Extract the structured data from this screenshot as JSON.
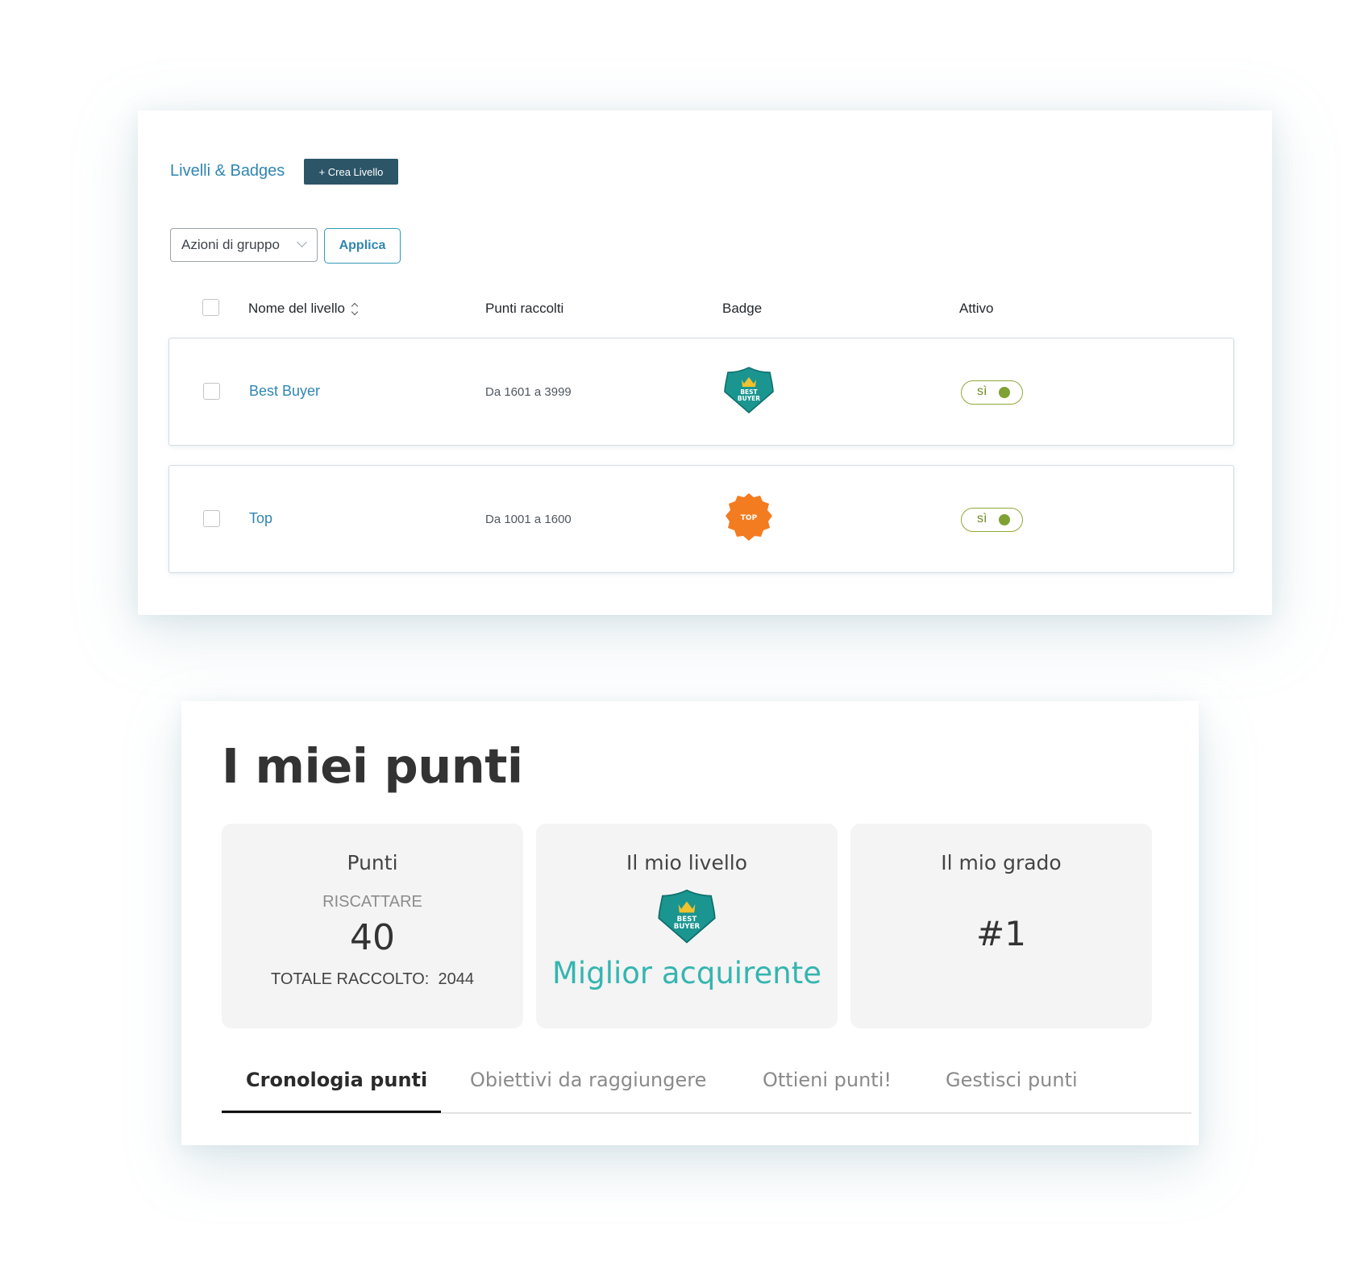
{
  "admin": {
    "title": "Livelli & Badges",
    "create_button": "+ Crea Livello",
    "bulk_actions": {
      "selected": "Azioni di gruppo"
    },
    "apply_button": "Applica",
    "columns": [
      "Nome del livello",
      "Punti raccolti",
      "Badge",
      "Attivo"
    ],
    "rows": [
      {
        "name": "Best Buyer",
        "range": "Da 1601 a 3999",
        "badge": {
          "icon": "best-buyer-badge-icon",
          "lines": [
            "BEST",
            "BUYER"
          ],
          "color": "#1a9590"
        },
        "active": "sì"
      },
      {
        "name": "Top",
        "range": "Da 1001 a 1600",
        "badge": {
          "icon": "top-badge-icon",
          "lines": [
            "TOP"
          ],
          "color": "#f47c20"
        },
        "active": "sì"
      }
    ],
    "colors": {
      "accent": "#2f86b3",
      "button_dark": "#2c5568",
      "toggle_green": "#7fa133"
    }
  },
  "front": {
    "title": "I miei punti",
    "points_box": {
      "title": "Punti",
      "redeem_label": "RISCATTARE",
      "redeem_value": "40",
      "total_label": "TOTALE RACCOLTO:",
      "total_value": "2044"
    },
    "level_box": {
      "title": "Il mio livello",
      "badge_lines": [
        "BEST",
        "BUYER"
      ],
      "level_name": "Miglior acquirente"
    },
    "rank_box": {
      "title": "Il mio grado",
      "rank": "#1"
    },
    "tabs": [
      {
        "label": "Cronologia punti",
        "active": true
      },
      {
        "label": "Obiettivi da raggiungere",
        "active": false
      },
      {
        "label": "Ottieni punti!",
        "active": false
      },
      {
        "label": "Gestisci punti",
        "active": false
      }
    ],
    "colors": {
      "level_teal": "#35b5b0"
    }
  }
}
